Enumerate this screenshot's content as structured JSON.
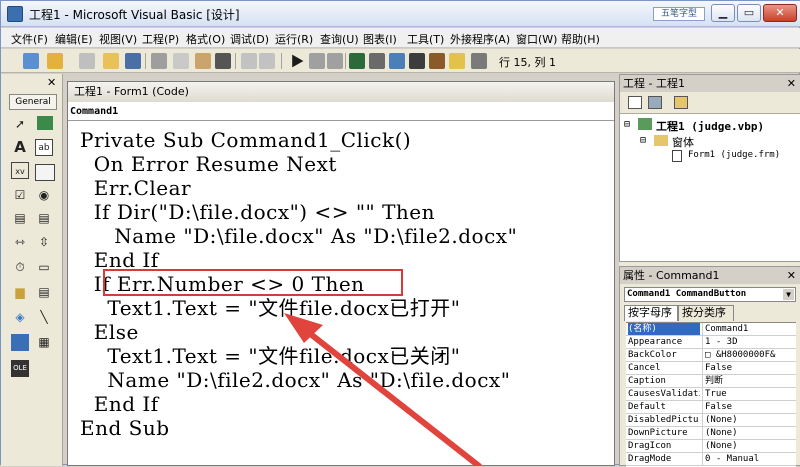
{
  "window": {
    "title": "工程1 - Microsoft Visual Basic [设计]",
    "watermark": "五笔字型",
    "minimize": "▁",
    "maximize": "▭",
    "close": "✕"
  },
  "menu": [
    "文件(F)",
    "编辑(E)",
    "视图(V)",
    "工程(P)",
    "格式(O)",
    "调试(D)",
    "运行(R)",
    "查询(U)",
    "图表(I)",
    "工具(T)",
    "外接程序(A)",
    "窗口(W)",
    "帮助(H)"
  ],
  "toolbar": {
    "position": "行 15, 列 1"
  },
  "toolbox": {
    "label": "General",
    "close": "✕"
  },
  "code_window": {
    "title": "工程1 - Form1 (Code)",
    "object": "Command1",
    "lines": [
      "Private Sub Command1_Click()",
      "  On Error Resume Next",
      "  Err.Clear",
      "  If Dir(\"D:\\file.docx\") <> \"\" Then",
      "     Name \"D:\\file.docx\" As \"D:\\file2.docx\"",
      "  End If",
      "  If Err.Number <> 0 Then",
      "    Text1.Text = \"文件file.docx已打开\"",
      "  Else",
      "    Text1.Text = \"文件file.docx已关闭\"",
      "    Name \"D:\\file2.docx\" As \"D:\\file.docx\"",
      "  End If",
      "End Sub"
    ]
  },
  "project_explorer": {
    "title": "工程 - 工程1",
    "close": "✕",
    "project": "工程1 (judge.vbp)",
    "folder": "窗体",
    "form": "Form1 (judge.frm)"
  },
  "properties": {
    "title": "属性 - Command1",
    "close": "✕",
    "object": "Command1 CommandButton",
    "tab_alpha": "按字母序",
    "tab_category": "按分类序",
    "rows": [
      {
        "key": "(名称)",
        "value": "Command1"
      },
      {
        "key": "Appearance",
        "value": "1 - 3D"
      },
      {
        "key": "BackColor",
        "value": "□ &H8000000F&"
      },
      {
        "key": "Cancel",
        "value": "False"
      },
      {
        "key": "Caption",
        "value": "判断"
      },
      {
        "key": "CausesValidati",
        "value": "True"
      },
      {
        "key": "Default",
        "value": "False"
      },
      {
        "key": "DisabledPictur",
        "value": "(None)"
      },
      {
        "key": "DownPicture",
        "value": "(None)"
      },
      {
        "key": "DragIcon",
        "value": "(None)"
      },
      {
        "key": "DragMode",
        "value": "0 - Manual"
      }
    ]
  },
  "colors": {
    "highlight_box": "#d83a3a",
    "arrow": "#e0443c",
    "selection": "#316ac5"
  }
}
